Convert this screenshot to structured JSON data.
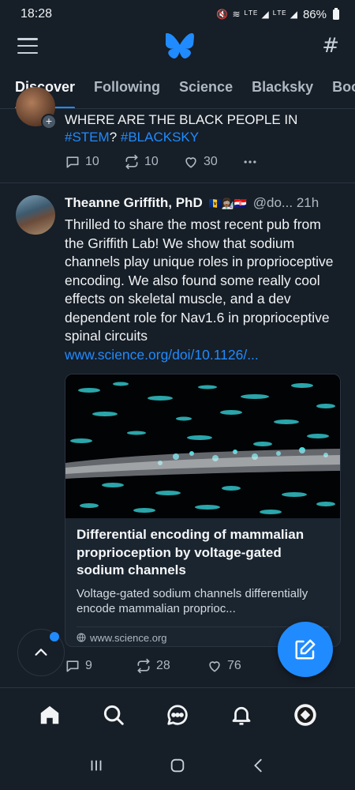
{
  "status_bar": {
    "time": "18:28",
    "icons": "🔇 ≋ ᴸᵀᴱ ◢ ᴸᵀᴱ ◢",
    "battery": "86%"
  },
  "app_bar": {
    "logo": "butterfly-logo-icon",
    "left_icon": "menu-icon",
    "right_icon": "hash-icon"
  },
  "tabs": [
    {
      "label": "Discover",
      "active": true
    },
    {
      "label": "Following"
    },
    {
      "label": "Science"
    },
    {
      "label": "Blacksky"
    },
    {
      "label": "Boo"
    }
  ],
  "post1": {
    "text_plain": "WHERE ARE THE BLACK PEOPLE IN ",
    "tag1": "#STEM",
    "mid": "? ",
    "tag2": "#BLACKSKY",
    "replies": "10",
    "reposts": "10",
    "likes": "30"
  },
  "post2": {
    "name": "Theanne Griffith, PhD",
    "flags": "🇧🇧👩🏾‍🔬🇭🇷",
    "handle": "@do...",
    "time": "21h",
    "body": "Thrilled to share the most recent pub from the Griffith Lab! We show that sodium channels play unique roles in proprioceptive encoding. We also found some really cool effects on skeletal muscle, and a dev dependent role for Nav1.6 in proprioceptive spinal circuits",
    "link": "www.science.org/doi/10.1126/...",
    "card": {
      "title": "Differential encoding of mammalian proprioception by voltage-gated sodium channels",
      "description": "Voltage-gated sodium channels differentially encode mammalian proprioc...",
      "source": "www.science.org"
    },
    "replies": "9",
    "reposts": "28",
    "likes": "76"
  },
  "colors": {
    "accent": "#208bfe",
    "background": "#161e27",
    "muted": "#aeb8c2"
  },
  "bottom_nav": [
    "home-icon",
    "search-icon",
    "chat-icon",
    "bell-icon",
    "profile-avatar"
  ],
  "system_nav": [
    "recents-icon",
    "home-button-icon",
    "back-icon"
  ]
}
